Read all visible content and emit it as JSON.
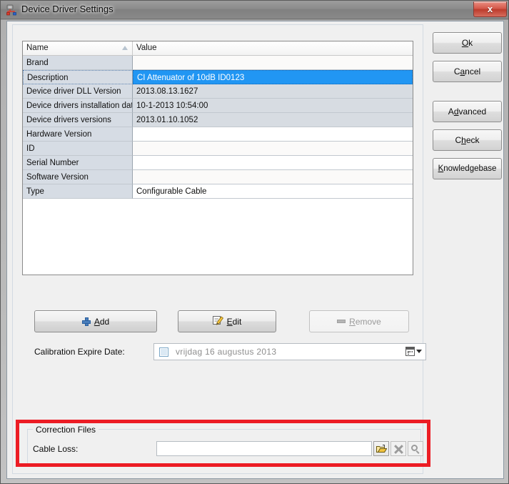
{
  "window": {
    "title": "Device Driver Settings",
    "icon": "device-driver-icon",
    "close_label": "x"
  },
  "grid": {
    "columns": [
      "Name",
      "Value"
    ],
    "sort_column": "Name",
    "sort_direction": "ascending",
    "rows": [
      {
        "name": "Brand",
        "value": ""
      },
      {
        "name": "Description",
        "value": "CI Attenuator of 10dB ID0123"
      },
      {
        "name": "Device driver DLL Version",
        "value": "2013.08.13.1627"
      },
      {
        "name": "Device drivers installation date",
        "value": "10-1-2013 10:54:00"
      },
      {
        "name": "Device drivers versions",
        "value": "2013.01.10.1052"
      },
      {
        "name": "Hardware Version",
        "value": ""
      },
      {
        "name": "ID",
        "value": ""
      },
      {
        "name": "Serial Number",
        "value": ""
      },
      {
        "name": "Software Version",
        "value": ""
      },
      {
        "name": "Type",
        "value": "Configurable Cable"
      }
    ],
    "selected_row_index": 1
  },
  "actions": {
    "add": {
      "label_pre": "",
      "accel": "A",
      "label_post": "dd",
      "full": "Add",
      "icon": "plus-icon",
      "enabled": true
    },
    "edit": {
      "label_pre": "",
      "accel": "E",
      "label_post": "dit",
      "full": "Edit",
      "icon": "edit-pencil-icon",
      "enabled": true
    },
    "remove": {
      "label_pre": "",
      "accel": "R",
      "label_post": "emove",
      "full": "Remove",
      "icon": "minus-icon",
      "enabled": false
    }
  },
  "calibration": {
    "label": "Calibration Expire Date:",
    "checked": false,
    "value": "vrijdag   16  augustus  2013",
    "day_name": "vrijdag",
    "day": "16",
    "month": "augustus",
    "year": "2013",
    "dropdown_icon": "calendar-icon"
  },
  "correction_files": {
    "group_title": "Correction Files",
    "cable_loss_label": "Cable Loss:",
    "cable_loss_value": "",
    "cable_loss_placeholder": "",
    "buttons": [
      {
        "name": "open-file-button",
        "icon": "open-folder-icon",
        "enabled": true
      },
      {
        "name": "clear-button",
        "icon": "x-icon",
        "enabled": false
      },
      {
        "name": "view-button",
        "icon": "magnifier-icon",
        "enabled": false
      }
    ],
    "highlight_color": "#ec1c24"
  },
  "side_buttons": [
    {
      "name": "ok-button",
      "pre": "",
      "accel": "O",
      "post": "k",
      "full": "Ok"
    },
    {
      "name": "cancel-button",
      "pre": "C",
      "accel": "a",
      "post": "ncel",
      "full": "Cancel"
    },
    {
      "name": "advanced-button",
      "pre": "A",
      "accel": "d",
      "post": "vanced",
      "full": "Advanced"
    },
    {
      "name": "check-button",
      "pre": "C",
      "accel": "h",
      "post": "eck",
      "full": "Check"
    },
    {
      "name": "knowledgebase-button",
      "pre": "",
      "accel": "K",
      "post": "nowledgebase",
      "full": "Knowledgebase"
    }
  ],
  "colors": {
    "selection_blue": "#2196f3",
    "name_column": "#d6dce4",
    "dialog_bg": "#efefef",
    "highlight_red": "#ec1c24"
  }
}
